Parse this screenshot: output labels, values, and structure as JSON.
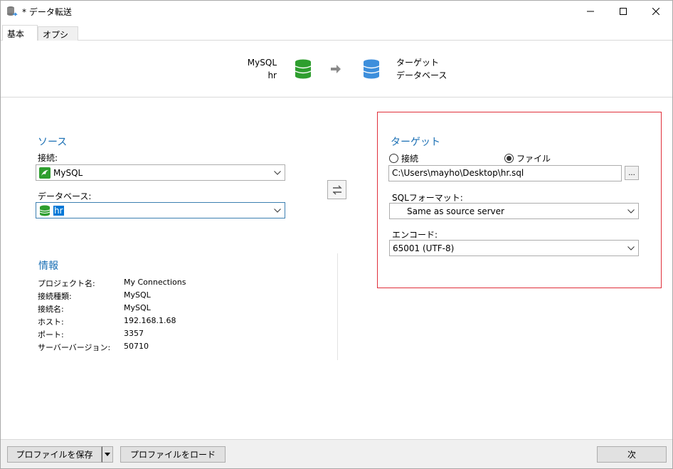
{
  "window": {
    "title": "* データ転送",
    "minimize_icon": "minimize-icon",
    "maximize_icon": "maximize-icon",
    "close_icon": "close-icon"
  },
  "tabs": [
    {
      "label": "基本",
      "active": true
    },
    {
      "label": "オプション",
      "active": false
    }
  ],
  "header": {
    "source_line1": "MySQL",
    "source_line2": "hr",
    "target_line1": "ターゲット",
    "target_line2": "データベース",
    "source_color": "#2e9e2e",
    "target_color": "#3d8fdc"
  },
  "source": {
    "title": "ソース",
    "connection_label": "接続:",
    "connection_value": "MySQL",
    "database_label": "データベース:",
    "database_value": "hr"
  },
  "info": {
    "title": "情報",
    "rows": [
      {
        "key": "プロジェクト名:",
        "value": "My Connections"
      },
      {
        "key": "接続種類:",
        "value": "MySQL"
      },
      {
        "key": "接続名:",
        "value": "MySQL"
      },
      {
        "key": "ホスト:",
        "value": "192.168.1.68"
      },
      {
        "key": "ポート:",
        "value": "3357"
      },
      {
        "key": "サーバーバージョン:",
        "value": "50710"
      }
    ]
  },
  "target": {
    "title": "ターゲット",
    "radio_connection": "接続",
    "radio_file": "ファイル",
    "selected": "file",
    "file_path": "C:\\Users\\mayho\\Desktop\\hr.sql",
    "browse_label": "...",
    "sql_format_label": "SQLフォーマット:",
    "sql_format_value": "Same as source server",
    "encoding_label": "エンコード:",
    "encoding_value": "65001 (UTF-8)",
    "highlight_color": "#e0303a"
  },
  "footer": {
    "save_profile": "プロファイルを保存",
    "load_profile": "プロファイルをロード",
    "next": "次"
  }
}
